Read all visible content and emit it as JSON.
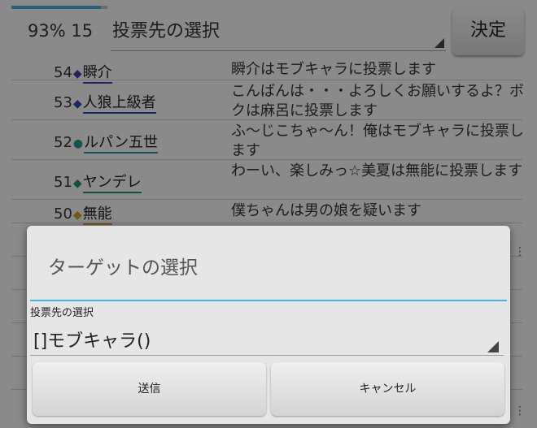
{
  "header": {
    "progress": 0.93,
    "status_text": "93% 15",
    "vote_select_value": "投票先の選択",
    "decide_label": "決定"
  },
  "log": [
    {
      "num": "54",
      "name": "瞬介",
      "color": "#3b3aa8",
      "message": "瞬介はモブキャラに投票します"
    },
    {
      "num": "53",
      "name": "人狼上級者",
      "color": "#2a4aa0",
      "message": "こんばんは・・・よろしくお願いするよ？ボクは麻呂に投票します"
    },
    {
      "num": "52",
      "name": "ルパン五世",
      "color": "#2a8f90",
      "message": "ふ～じこちゃ～ん！俺はモブキャラに投票します"
    },
    {
      "num": "51",
      "name": "ヤンデレ",
      "color": "#1f8f5a",
      "message": "わーい、楽しみっ☆美夏は無能に投票します"
    },
    {
      "num": "50",
      "name": "無能",
      "color": "#c8951a",
      "message": "僕ちゃんは男の娘を疑います"
    }
  ],
  "dialog": {
    "title": "ターゲットの選択",
    "field_label": "投票先の選択",
    "selected_value": "[]モブキャラ()",
    "send_label": "送信",
    "cancel_label": "キャンセル"
  },
  "colors": {
    "accent": "#42b4e6",
    "progress": "#3fa9d4"
  }
}
